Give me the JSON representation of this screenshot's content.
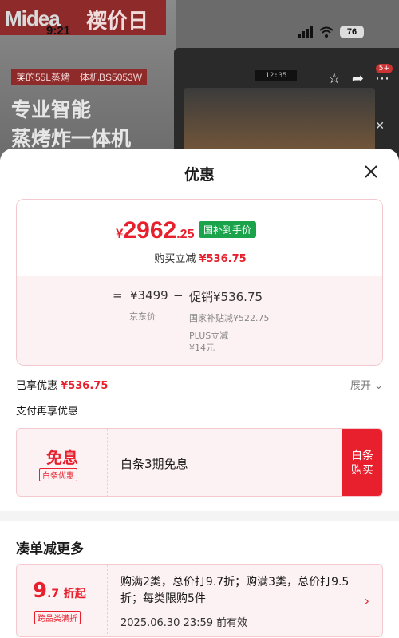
{
  "background": {
    "brand_logo": "Midea",
    "brand_tag": "褉价日",
    "status_time": "9:21",
    "battery": "76",
    "product_name": "美的55L蒸烤一体机BS5053W",
    "slogan_line1": "专业智能",
    "slogan_line2": "蒸烤炸一体机",
    "oven_display": "12:35",
    "cart_badge": "5+"
  },
  "sheet": {
    "title": "优惠"
  },
  "price_card": {
    "currency": "¥",
    "final_int": "2962",
    "final_dec": ".25",
    "subsidy_tag": "国补到手价",
    "instant_label": "购买立减",
    "instant_value": "¥536.75",
    "equals": "=",
    "jd_price": "¥3499",
    "minus": "−",
    "promo_label": "促销¥536.75",
    "jd_price_label": "京东价",
    "subsidy_detail": "国家补贴减¥522.75",
    "plus_label": "PLUS立减",
    "plus_value": "¥14元"
  },
  "summary": {
    "enjoyed_label": "已享优惠",
    "enjoyed_value": "¥536.75",
    "expand_label": "展开"
  },
  "pay_more": {
    "title": "支付再享优惠"
  },
  "baitiao": {
    "big": "免息",
    "tag": "白条优惠",
    "desc": "白条3期免息",
    "button_line1": "白条",
    "button_line2": "购买"
  },
  "more_section": {
    "title": "凑单减更多"
  },
  "promo": {
    "rate_int": "9",
    "rate_dec": ".7",
    "rate_unit": "折起",
    "tag": "跨品类满折",
    "desc": "购满2类，总价打9.7折；购满3类，总价打9.5折；每类限购5件",
    "valid": "2025.06.30 23:59 前有效"
  },
  "colors": {
    "accent_red": "#e8202e",
    "subsidy_green": "#1aa34a",
    "card_pink": "#fdf2f3"
  }
}
